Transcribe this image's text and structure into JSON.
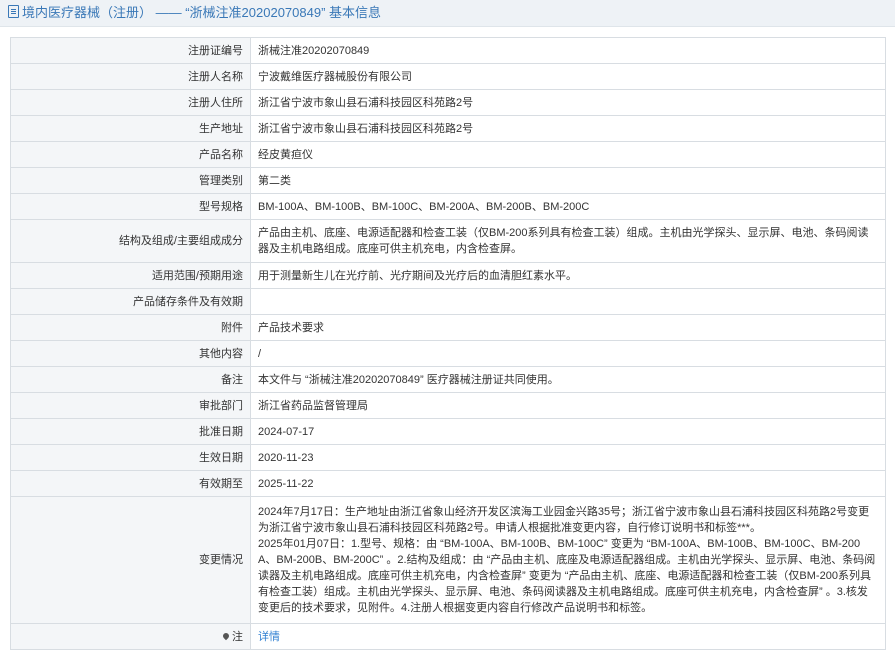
{
  "header": {
    "title": "境内医疗器械（注册） —— “浙械注准20202070849” 基本信息"
  },
  "rows": [
    {
      "label": "注册证编号",
      "value": "浙械注准20202070849"
    },
    {
      "label": "注册人名称",
      "value": "宁波戴维医疗器械股份有限公司"
    },
    {
      "label": "注册人住所",
      "value": "浙江省宁波市象山县石浦科技园区科苑路2号"
    },
    {
      "label": "生产地址",
      "value": "浙江省宁波市象山县石浦科技园区科苑路2号"
    },
    {
      "label": "产品名称",
      "value": "经皮黄疸仪"
    },
    {
      "label": "管理类别",
      "value": "第二类"
    },
    {
      "label": "型号规格",
      "value": "BM-100A、BM-100B、BM-100C、BM-200A、BM-200B、BM-200C"
    },
    {
      "label": "结构及组成/主要组成成分",
      "value": "产品由主机、底座、电源适配器和检查工装（仅BM-200系列具有检查工装）组成。主机由光学探头、显示屏、电池、条码阅读器及主机电路组成。底座可供主机充电，内含检查屏。"
    },
    {
      "label": "适用范围/预期用途",
      "value": "用于测量新生儿在光疗前、光疗期间及光疗后的血清胆红素水平。"
    },
    {
      "label": "产品储存条件及有效期",
      "value": ""
    },
    {
      "label": "附件",
      "value": "产品技术要求"
    },
    {
      "label": "其他内容",
      "value": "/"
    },
    {
      "label": "备注",
      "value": "本文件与 “浙械注准20202070849” 医疗器械注册证共同使用。"
    },
    {
      "label": "审批部门",
      "value": "浙江省药品监督管理局"
    },
    {
      "label": "批准日期",
      "value": "2024-07-17"
    },
    {
      "label": "生效日期",
      "value": "2020-11-23"
    },
    {
      "label": "有效期至",
      "value": "2025-11-22"
    }
  ],
  "changes": {
    "label": "变更情况",
    "entry1": "2024年7月17日：生产地址由浙江省象山经济开发区滨海工业园金兴路35号；浙江省宁波市象山县石浦科技园区科苑路2号变更为浙江省宁波市象山县石浦科技园区科苑路2号。申请人根据批准变更内容，自行修订说明书和标签***。",
    "entry2": "2025年01月07日：1.型号、规格：由 “BM-100A、BM-100B、BM-100C” 变更为 “BM-100A、BM-100B、BM-100C、BM-200A、BM-200B、BM-200C” 。2.结构及组成：由 “产品由主机、底座及电源适配器组成。主机由光学探头、显示屏、电池、条码阅读器及主机电路组成。底座可供主机充电，内含检查屏” 变更为 “产品由主机、底座、电源适配器和检查工装（仅BM-200系列具有检查工装）组成。主机由光学探头、显示屏、电池、条码阅读器及主机电路组成。底座可供主机充电，内含检查屏” 。3.核发变更后的技术要求，见附件。4.注册人根据变更内容自行修改产品说明书和标签。"
  },
  "note": {
    "label": "注",
    "link": "详情"
  }
}
